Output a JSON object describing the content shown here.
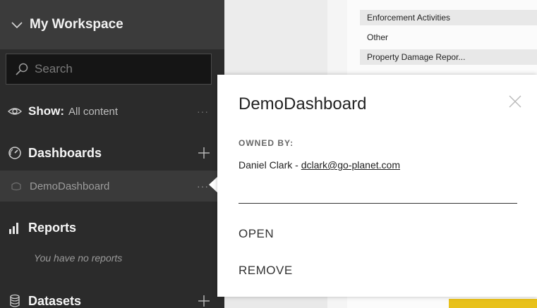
{
  "nav": {
    "workspace_title": "My Workspace",
    "search_placeholder": "Search",
    "show_label": "Show:",
    "show_value": "All content",
    "show_more": "···",
    "dashboards_label": "Dashboards",
    "dashboard_item": "DemoDashboard",
    "dashboard_more": "···",
    "reports_label": "Reports",
    "reports_empty": "You have no reports",
    "datasets_label": "Datasets",
    "icons": [
      "chevron-down-icon",
      "search-icon",
      "eye-icon",
      "dashboard-gauge-icon",
      "plus-icon",
      "dashboard-item-icon",
      "bar-chart-icon",
      "database-icon"
    ]
  },
  "background_table": {
    "rows": [
      "Enforcement Activities",
      "Other",
      "Property Damage Repor..."
    ]
  },
  "popover": {
    "title": "DemoDashboard",
    "owned_by_label": "OWNED BY:",
    "owner_name": "Daniel Clark - ",
    "owner_email": "dclark@go-planet.com",
    "open_label": "OPEN",
    "remove_label": "REMOVE",
    "close_icon": "close-icon"
  },
  "colors": {
    "nav_bg": "#2b2b2b",
    "nav_header_bg": "#3b3b3b",
    "selected_item_bg": "#3a3a3a",
    "popover_bg": "#ffffff",
    "accent_yellow": "#e8c11b"
  }
}
